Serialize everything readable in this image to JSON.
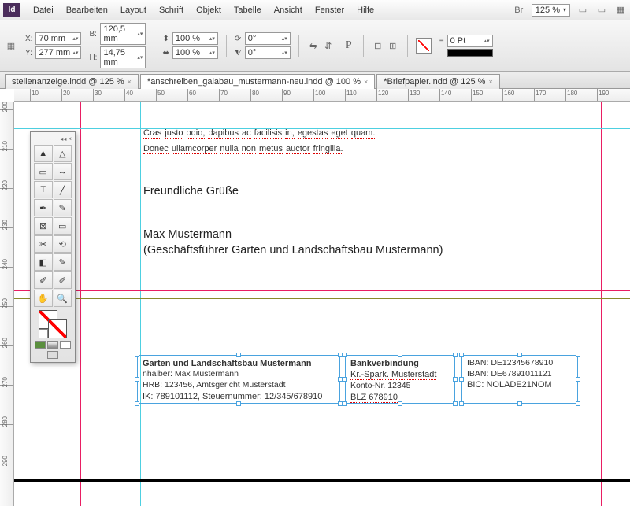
{
  "menu": [
    "Datei",
    "Bearbeiten",
    "Layout",
    "Schrift",
    "Objekt",
    "Tabelle",
    "Ansicht",
    "Fenster",
    "Hilfe"
  ],
  "zoom": "125 %",
  "control": {
    "x_lbl": "X:",
    "x": "70 mm",
    "y_lbl": "Y:",
    "y": "277 mm",
    "w_lbl": "B:",
    "w": "120,5 mm",
    "h_lbl": "H:",
    "h": "14,75 mm",
    "sx": "100 %",
    "sy": "100 %",
    "rot": "0°",
    "shr": "0°",
    "stroke": "0 Pt"
  },
  "tabs": [
    {
      "label": "stellenanzeige.indd @ 125 %",
      "active": false
    },
    {
      "label": "*anschreiben_galabau_mustermann-neu.indd @ 100 %",
      "active": true
    },
    {
      "label": "*Briefpapier.indd @ 125 %",
      "active": false
    }
  ],
  "ruler_h": [
    10,
    20,
    30,
    40,
    50,
    60,
    70,
    80,
    90,
    100,
    110,
    120,
    130,
    140,
    150,
    160,
    170,
    180,
    190
  ],
  "ruler_v": [
    200,
    210,
    220,
    230,
    240,
    250,
    260,
    270,
    280,
    290
  ],
  "body": {
    "line1": [
      "Cras",
      "justo",
      "odio,",
      "dapibus",
      "ac",
      "facilisis",
      "in,",
      "egestas",
      "eget",
      "quam."
    ],
    "line2": [
      "Donec",
      "ullamcorper",
      "nulla",
      "non",
      "metus",
      "auctor",
      "fringilla."
    ],
    "closing": "Freundliche Grüße",
    "name": "Max Mustermann",
    "role": "(Geschäftsführer Garten und Landschaftsbau Mustermann)"
  },
  "footer": {
    "col1": {
      "title": "Garten und Landschaftsbau Mustermann",
      "rows": [
        "nhalber: Max Mustermann",
        "HRB: 123456, Amtsgericht Musterstadt",
        "IK: 789101112, Steuernummer: 12/345/678910"
      ]
    },
    "col2": {
      "title": "Bankverbindung",
      "rows": [
        "Kr.-Spark. Musterstadt",
        "Konto-Nr. 12345",
        "BLZ 678910"
      ]
    },
    "col3": {
      "rows": [
        "IBAN: DE12345678910",
        "IBAN: DE67891011121",
        "BIC: NOLADE21NOM"
      ]
    }
  }
}
